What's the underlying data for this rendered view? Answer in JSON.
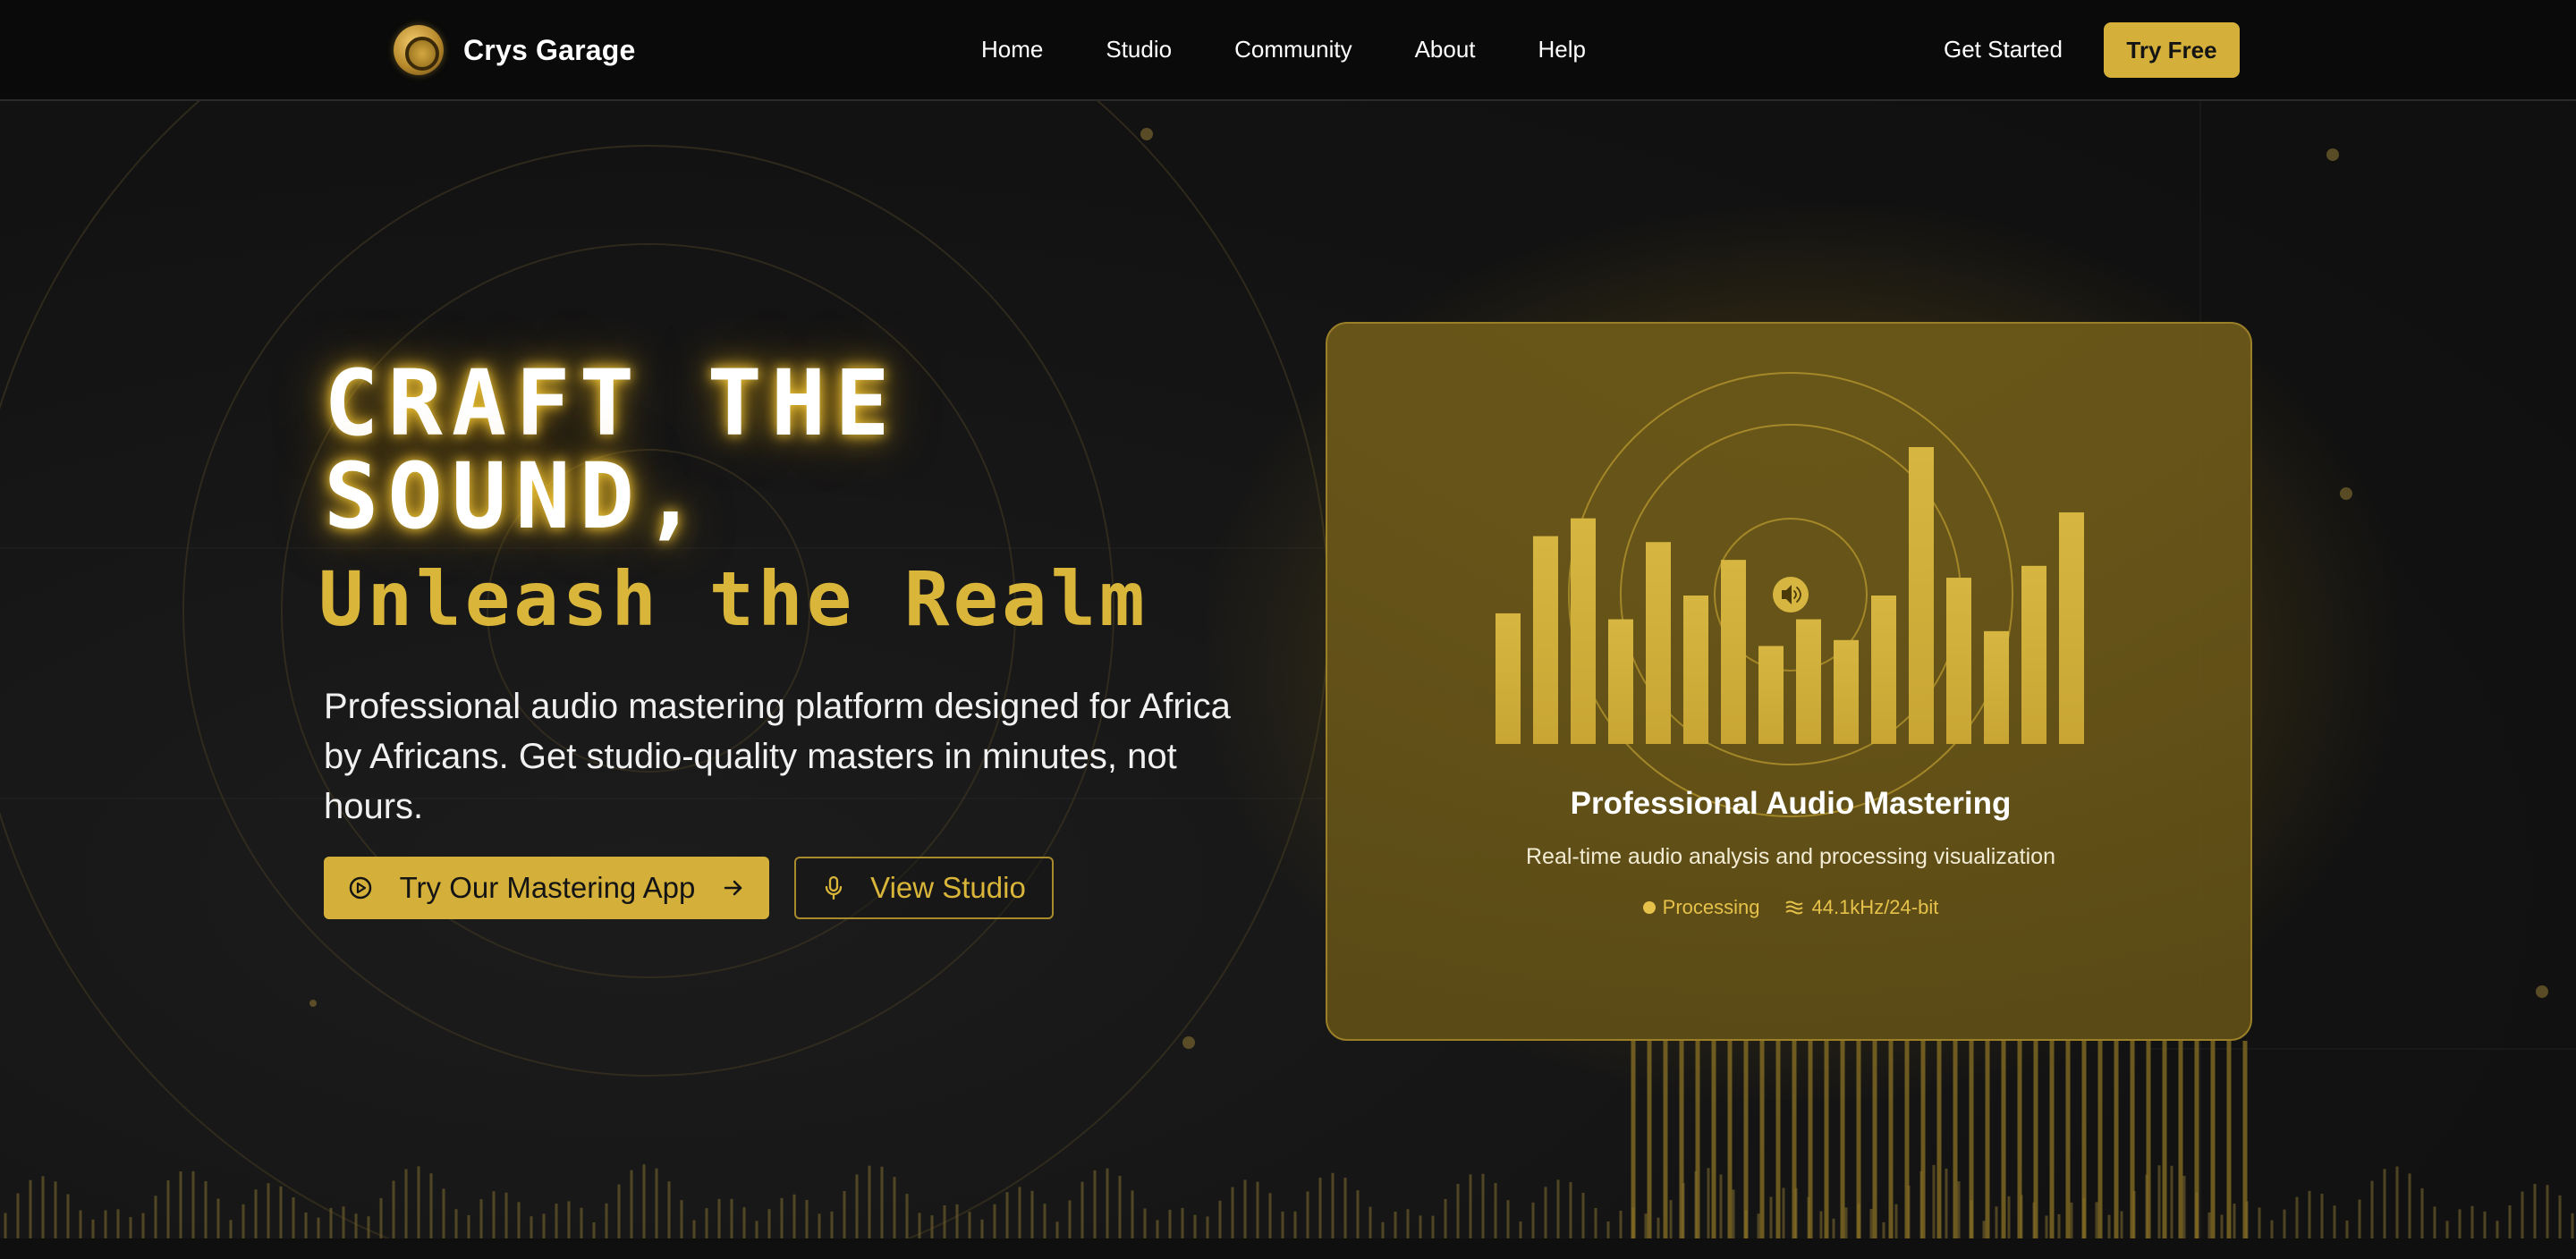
{
  "header": {
    "brand_name": "Crys Garage",
    "nav": [
      "Home",
      "Studio",
      "Community",
      "About",
      "Help"
    ],
    "get_started_label": "Get Started",
    "try_free_label": "Try Free"
  },
  "hero": {
    "title": "CRAFT THE SOUND,",
    "subtitle": "Unleash the Realm",
    "description": "Professional audio mastering platform designed for Africa by Africans. Get studio-quality masters in minutes, not hours.",
    "primary_cta": "Try Our Mastering App",
    "secondary_cta": "View Studio"
  },
  "visual_card": {
    "title": "Professional Audio Mastering",
    "description": "Real-time audio analysis and processing visualization",
    "status": "Processing",
    "format": "44.1kHz/24-bit",
    "bar_levels": [
      0.44,
      0.7,
      0.76,
      0.42,
      0.68,
      0.5,
      0.62,
      0.33,
      0.42,
      0.35,
      0.5,
      1.0,
      0.56,
      0.38,
      0.6,
      0.78
    ]
  },
  "colors": {
    "accent": "#d4b03a",
    "background": "#141414",
    "header_bg": "#0a0a0a"
  },
  "icons": {
    "logo": "vinyl-disc-logo",
    "primary_cta_left": "play-circle-icon",
    "primary_cta_right": "arrow-right-icon",
    "secondary_cta": "microphone-icon",
    "card_center": "speaker-icon",
    "format": "waves-icon"
  }
}
